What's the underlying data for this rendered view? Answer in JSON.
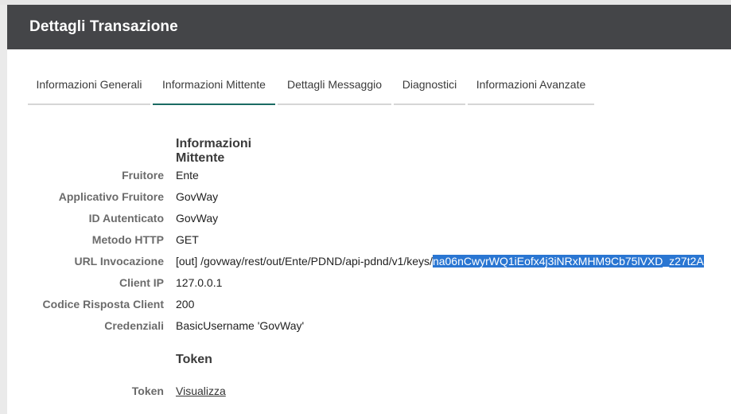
{
  "header": {
    "title": "Dettagli Transazione"
  },
  "tabs": [
    {
      "label": "Informazioni Generali"
    },
    {
      "label": "Informazioni Mittente"
    },
    {
      "label": "Dettagli Messaggio"
    },
    {
      "label": "Diagnostici"
    },
    {
      "label": "Informazioni Avanzate"
    }
  ],
  "active_tab": "Informazioni Mittente",
  "sections": {
    "mittente": {
      "title": "Informazioni Mittente",
      "rows": [
        {
          "label": "Fruitore",
          "value": "Ente"
        },
        {
          "label": "Applicativo Fruitore",
          "value": "GovWay"
        },
        {
          "label": "ID Autenticato",
          "value": "GovWay"
        },
        {
          "label": "Metodo HTTP",
          "value": "GET"
        },
        {
          "label": "URL Invocazione",
          "value_prefix": "[out] /govway/rest/out/Ente/PDND/api-pdnd/v1/keys/",
          "value_selected": "na06nCwyrWQ1iEofx4j3iNRxMHM9Cb75lVXD_z27t2A"
        },
        {
          "label": "Client IP",
          "value": "127.0.0.1"
        },
        {
          "label": "Codice Risposta Client",
          "value": "200"
        },
        {
          "label": "Credenziali",
          "value": "BasicUsername 'GovWay'"
        }
      ]
    },
    "token": {
      "title": "Token",
      "rows": [
        {
          "label": "Token",
          "link": "Visualizza"
        }
      ]
    }
  },
  "colors": {
    "header_bg": "#444548",
    "active_tab_underline": "#1b6b63",
    "selection_bg": "#2a76d2"
  }
}
